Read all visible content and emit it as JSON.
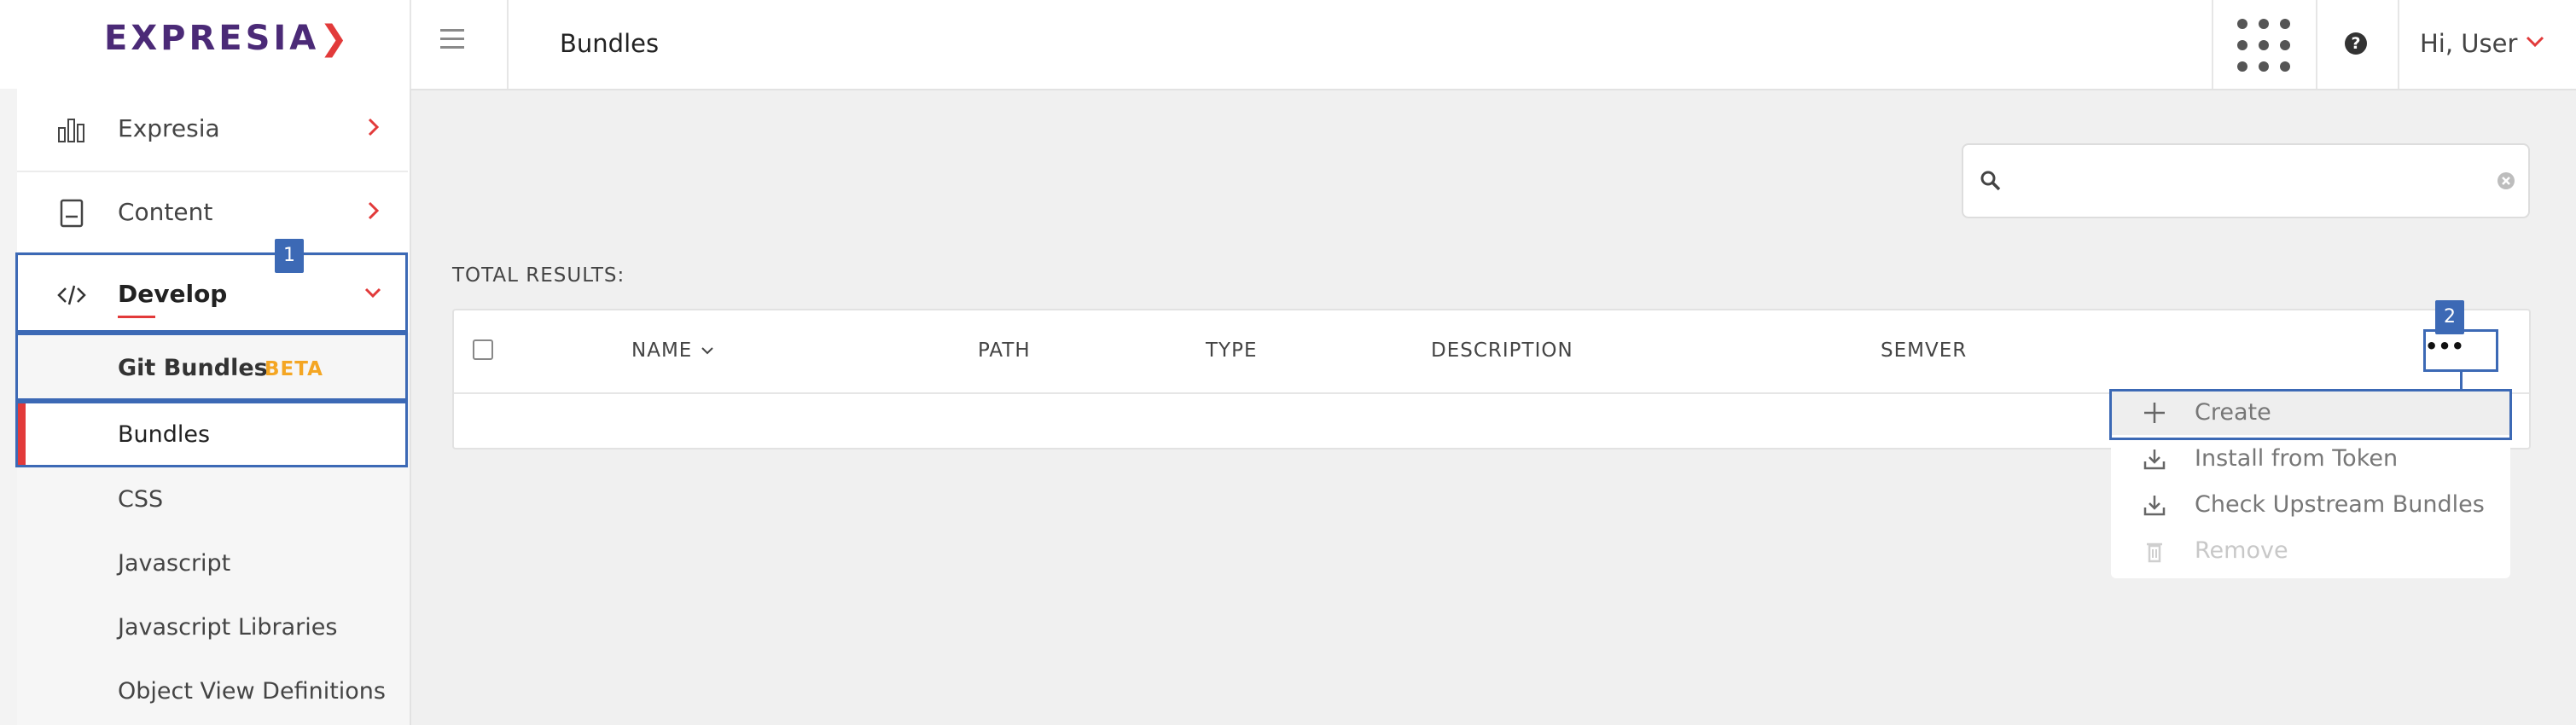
{
  "app": {
    "logo_text": "EXPRESIA",
    "logo_chevron": "❯",
    "page_title": "Bundles",
    "user_greeting": "Hi, User",
    "help_glyph": "?",
    "brand_colors": {
      "purple": "#4b2a77",
      "accent_red": "#e23a3a",
      "highlight_blue": "#3c69b5",
      "beta_orange": "#f4a623"
    }
  },
  "header": {
    "icons": [
      "menu-icon",
      "apps-grid-icon",
      "help-icon",
      "chevron-down-icon"
    ]
  },
  "sidebar": {
    "items": [
      {
        "label": "Expresia",
        "icon": "bar-chart-icon",
        "expanded": false
      },
      {
        "label": "Content",
        "icon": "book-icon",
        "expanded": false
      },
      {
        "label": "Develop",
        "icon": "code-icon",
        "expanded": true
      }
    ],
    "develop_children": [
      {
        "label": "Git Bundles",
        "badge": "BETA",
        "active": false
      },
      {
        "label": "Bundles",
        "active": true
      },
      {
        "label": "CSS",
        "active": false
      },
      {
        "label": "Javascript",
        "active": false
      },
      {
        "label": "Javascript Libraries",
        "active": false
      },
      {
        "label": "Object View Definitions",
        "active": false
      }
    ]
  },
  "annotations": {
    "marker_1": "1",
    "marker_2": "2"
  },
  "main": {
    "search": {
      "value": "",
      "placeholder": ""
    },
    "total_results_label": "TOTAL RESULTS:",
    "table": {
      "columns": [
        "NAME",
        "PATH",
        "TYPE",
        "DESCRIPTION",
        "SEMVER"
      ],
      "sorted_column": "NAME",
      "more_button_glyph": "•••",
      "rows": []
    },
    "actions_menu": [
      {
        "label": "Create",
        "icon": "plus-icon",
        "enabled": true
      },
      {
        "label": "Install from Token",
        "icon": "download-icon",
        "enabled": true
      },
      {
        "label": "Check Upstream Bundles",
        "icon": "download-icon",
        "enabled": true
      },
      {
        "label": "Remove",
        "icon": "trash-icon",
        "enabled": false
      }
    ]
  }
}
